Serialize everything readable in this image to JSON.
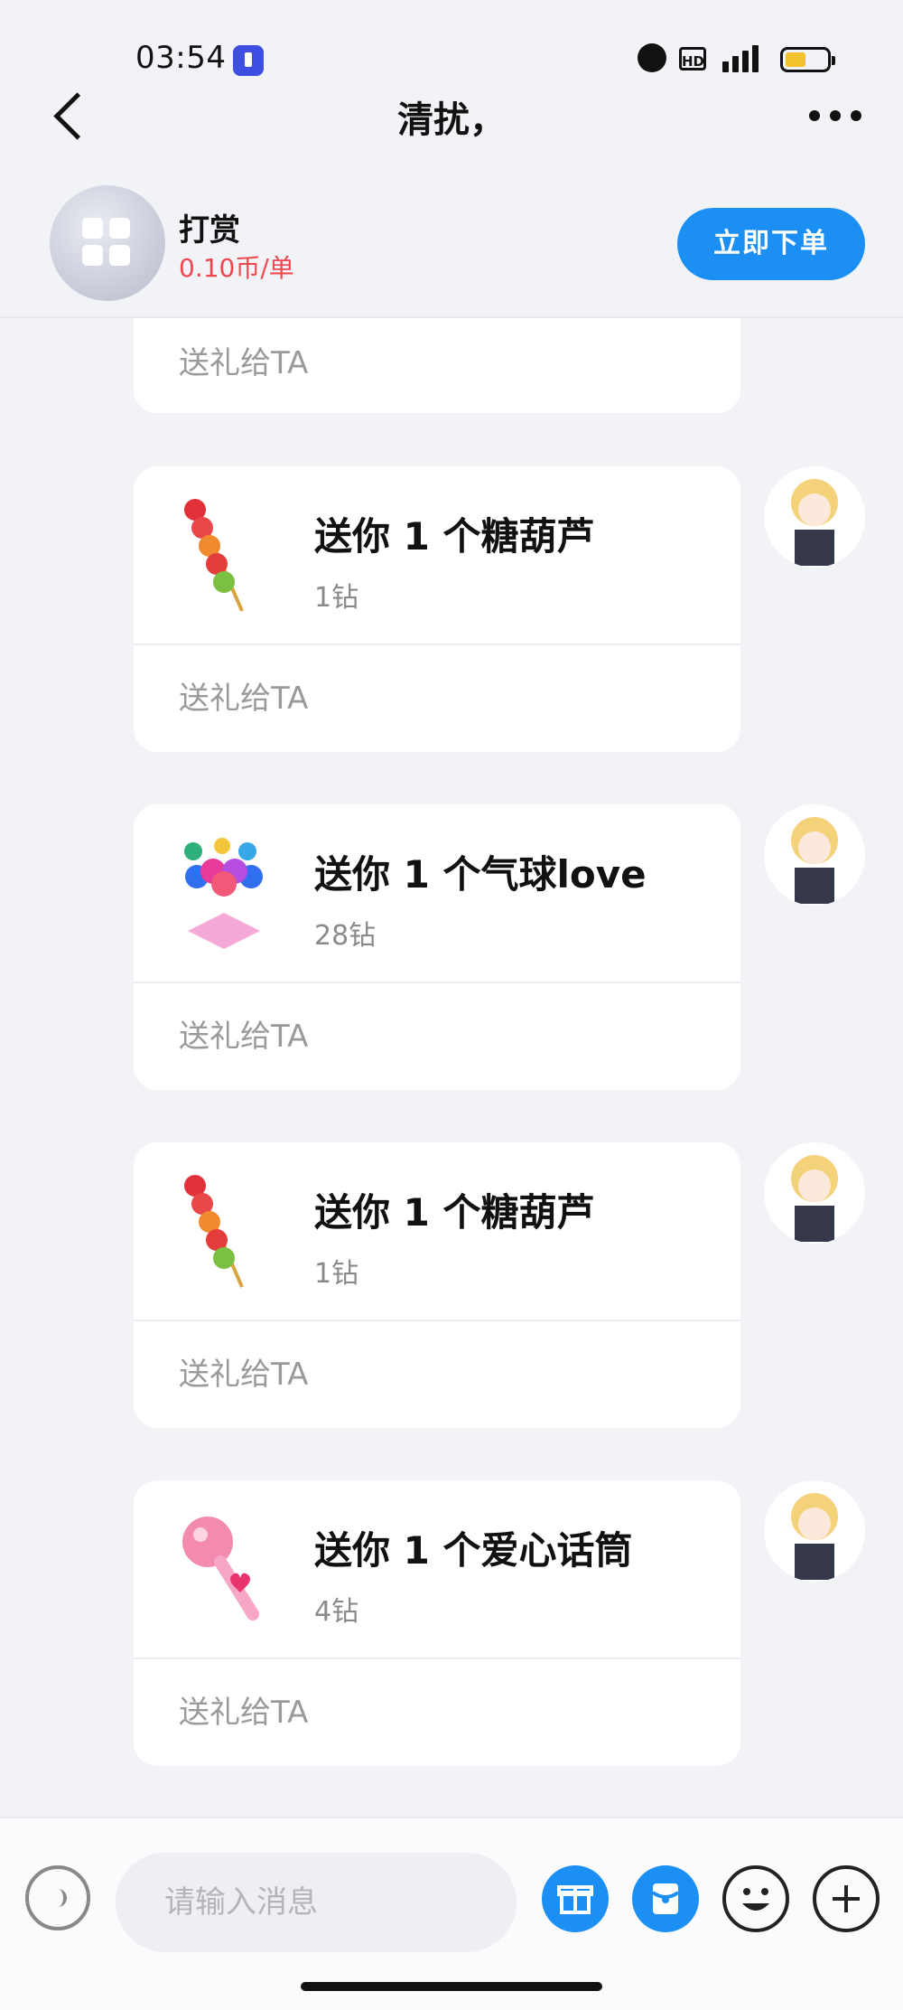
{
  "status_bar": {
    "time": "03:54"
  },
  "nav": {
    "title": "清扰，"
  },
  "service": {
    "name": "打赏",
    "price": "0.10币/单",
    "order_label": "立即下单"
  },
  "send_label": "送礼给TA",
  "messages": [
    {
      "title": "送你 1 个糖葫芦",
      "price": "1钻",
      "icon": "candied-haws-icon"
    },
    {
      "title": "送你 1 个气球love",
      "price": "28钻",
      "icon": "balloon-love-icon"
    },
    {
      "title": "送你 1 个糖葫芦",
      "price": "1钻",
      "icon": "candied-haws-icon"
    },
    {
      "title": "送你 1 个爱心话筒",
      "price": "4钻",
      "icon": "heart-microphone-icon"
    }
  ],
  "input": {
    "placeholder": "请输入消息"
  },
  "colors": {
    "accent": "#1c8ff5",
    "price_red": "#f0464d",
    "background": "#f2f3f7"
  }
}
